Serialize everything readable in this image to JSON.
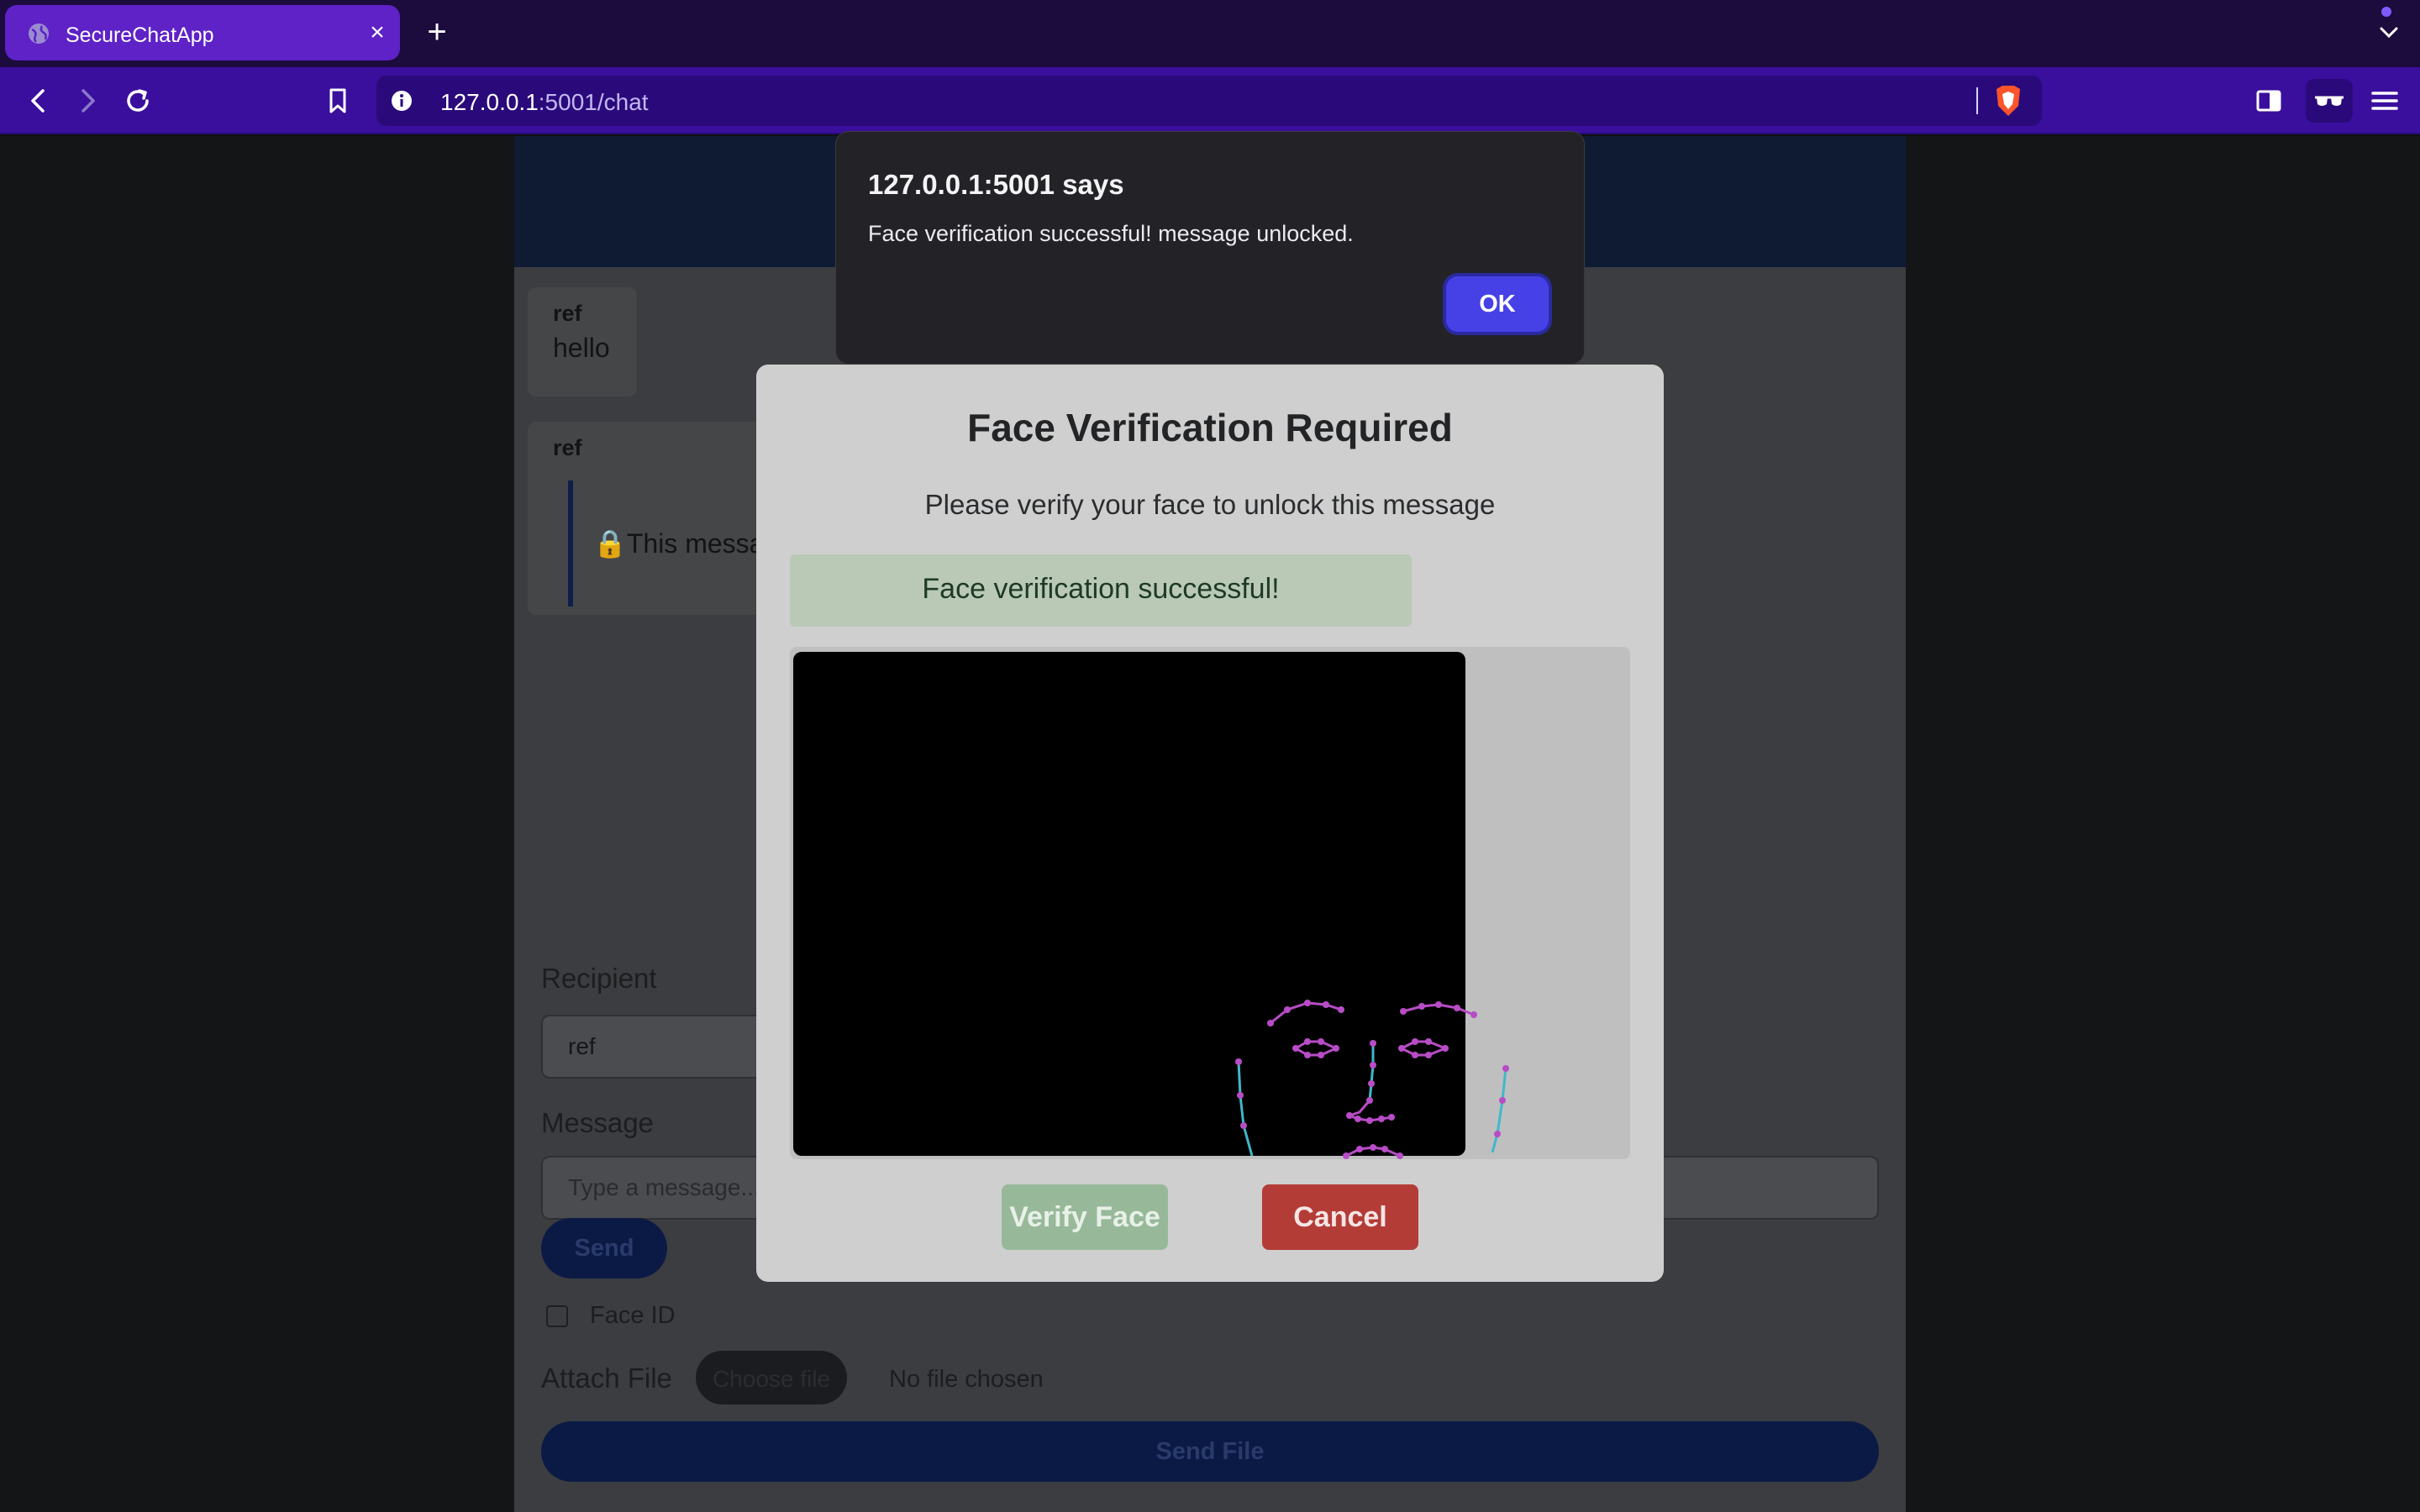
{
  "browser": {
    "tab_title": "SecureChatApp",
    "url_host": "127.0.0.1",
    "url_path": ":5001/chat",
    "accent_color": "#5e22c7",
    "toolbar_color": "#3a0f9d"
  },
  "chat": {
    "messages": [
      {
        "sender": "ref",
        "text": "hello"
      },
      {
        "sender": "ref",
        "text": "🔒This messa"
      }
    ],
    "form": {
      "recipient_label": "Recipient",
      "recipient_value": "ref",
      "message_label": "Message",
      "message_placeholder": "Type a message...",
      "send_label": "Send",
      "face_id_label": "Face ID",
      "attach_label": "Attach File",
      "choose_file_label": "Choose file",
      "no_file_label": "No file chosen",
      "send_file_label": "Send File"
    }
  },
  "modal": {
    "title": "Face Verification Required",
    "subtitle": "Please verify your face to unlock this message",
    "status": "Face verification successful!",
    "verify_label": "Verify Face",
    "cancel_label": "Cancel",
    "status_color": "#b9c9b6",
    "cancel_color": "#b43c37"
  },
  "alert": {
    "title": "127.0.0.1:5001 says",
    "message": "Face verification successful! message unlocked.",
    "ok_label": "OK",
    "ok_color": "#4641e6"
  }
}
